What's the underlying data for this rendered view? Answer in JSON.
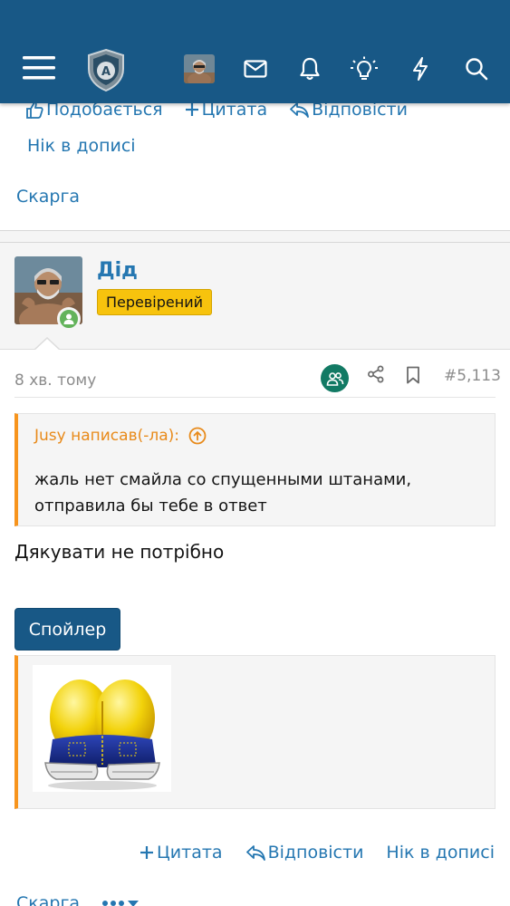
{
  "header": {
    "icons": [
      "menu-icon",
      "shield-logo-icon",
      "user-avatar",
      "mail-icon",
      "bell-icon",
      "lightbulb-icon",
      "lightning-icon",
      "search-icon"
    ],
    "colors": {
      "bar": "#185886",
      "icon": "#ffffff"
    }
  },
  "prev_post": {
    "like_label": "Подобається",
    "quote_label": "Цитата",
    "reply_label": "Відповісти",
    "nick_label": "Нік в дописі",
    "report_label": "Скарга"
  },
  "post": {
    "username": "Дід",
    "user_title": "Перевірений",
    "time": "8 хв. тому",
    "number": "#5,113",
    "quote": {
      "author": "Jusy написав(-ла):",
      "text": "жаль нет смайла со спущенными штанами, отправила бы тебе в ответ"
    },
    "message": "Дякувати не потрібно",
    "spoiler_label": "Спойлер",
    "actions": {
      "quote_label": "Цитата",
      "reply_label": "Відповісти",
      "nick_label": "Нік в дописі",
      "report_label": "Скарга"
    }
  },
  "colors": {
    "link": "#2577b1",
    "accent_orange": "#f7941d",
    "badge_yellow": "#f7c30d",
    "online_green": "#63b35b"
  }
}
